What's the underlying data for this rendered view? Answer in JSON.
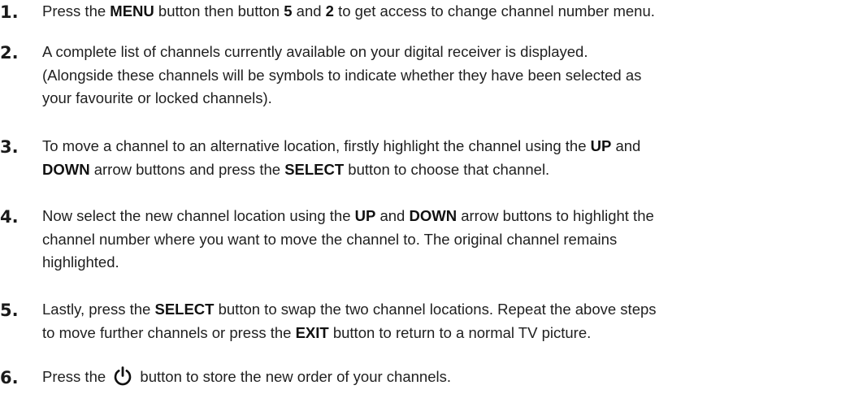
{
  "steps": [
    {
      "number": "1.",
      "lines": [
        {
          "t1": "Press the ",
          "b1": "MENU",
          "t2": " button then button ",
          "b2": "5",
          "t3": " and ",
          "b3": "2",
          "t4": " to get access to change channel number menu."
        }
      ]
    },
    {
      "number": "2.",
      "lines": [
        {
          "t1": "A complete list of channels currently available on your digital receiver is displayed."
        },
        {
          "t1": "(Alongside these channels will be symbols to indicate whether they have been selected as"
        },
        {
          "t1": "your favourite or locked channels)."
        }
      ]
    },
    {
      "number": "3.",
      "lines": [
        {
          "t1": "To move a channel to an alternative location, firstly highlight the channel using the ",
          "b1": "UP",
          "t2": " and"
        },
        {
          "b1": "DOWN",
          "t1": " arrow buttons and press the ",
          "b2": "SELECT",
          "t2": " button to choose that channel."
        }
      ]
    },
    {
      "number": "4.",
      "lines": [
        {
          "t1": "Now select the new channel location using the ",
          "b1": "UP",
          "t2": " and ",
          "b2": "DOWN",
          "t3": " arrow buttons to highlight the"
        },
        {
          "t1": "channel number where you want to move the channel to. The original channel remains"
        },
        {
          "t1": "highlighted."
        }
      ]
    },
    {
      "number": "5.",
      "lines": [
        {
          "t1": "Lastly, press the ",
          "b1": "SELECT",
          "t2": " button to swap the two channel locations. Repeat the above steps"
        },
        {
          "t1": "to move further channels or press the ",
          "b1": "EXIT",
          "t2": " button to return to a normal TV picture."
        }
      ]
    },
    {
      "number": "6.",
      "lines": [
        {
          "t1": "Press the ",
          "icon": "power-icon",
          "t2": " button to store the new order of your channels."
        }
      ]
    }
  ]
}
